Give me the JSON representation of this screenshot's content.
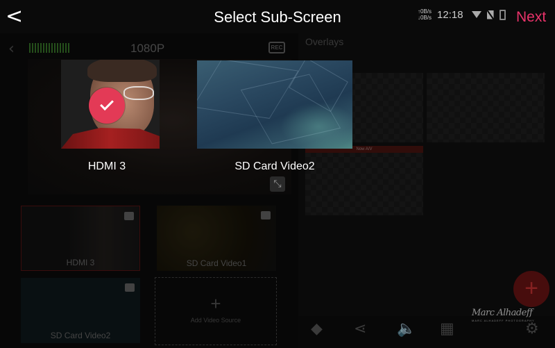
{
  "header": {
    "back_icon": "chevron-left-icon",
    "title": "Select Sub-Screen",
    "next_label": "Next"
  },
  "status_bar": {
    "net_up": "0B/s",
    "net_down": "0B/s",
    "time": "12:18",
    "icons": [
      "wifi-icon",
      "sim-off-icon",
      "battery-icon"
    ]
  },
  "choices": [
    {
      "label": "HDMI 3",
      "selected": true,
      "badge_color": "#e33a56"
    },
    {
      "label": "SD Card Video2",
      "selected": false
    }
  ],
  "background_app": {
    "resolution": "1080P",
    "rec_label": "REC",
    "overlays_label": "Overlays",
    "overlay_bar_text": "Now A/V",
    "sources": [
      {
        "label": "HDMI 3"
      },
      {
        "label": "SD Card Video1"
      },
      {
        "label": "SD Card Video2"
      }
    ],
    "add_source_label": "Add Video Source",
    "add_source_plus": "+",
    "fab_plus": "+",
    "signature_script": "Marc Alhadeff",
    "signature_small": "MARC ALHADEFF PHOTOGRAPHY"
  },
  "colors": {
    "accent": "#e8336a",
    "check_badge": "#e33a56"
  }
}
